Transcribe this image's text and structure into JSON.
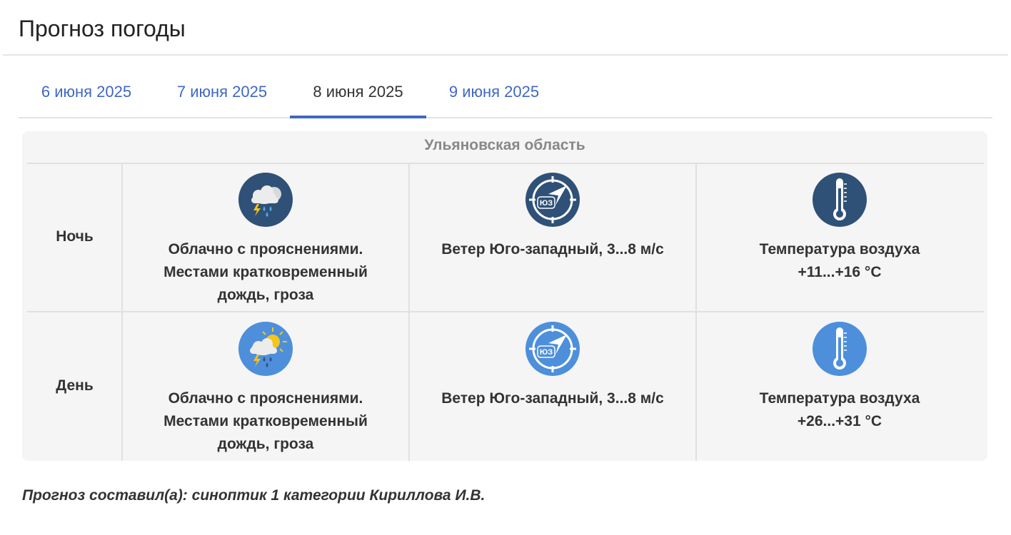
{
  "page_title": "Прогноз погоды",
  "tabs": [
    {
      "label": "6 июня 2025",
      "active": false
    },
    {
      "label": "7 июня 2025",
      "active": false
    },
    {
      "label": "8 июня 2025",
      "active": true
    },
    {
      "label": "9 июня 2025",
      "active": false
    }
  ],
  "region": "Ульяновская область",
  "rows": [
    {
      "period": "Ночь",
      "weather_icon": "night-cloud-rain-thunder-icon",
      "weather_text": "Облачно с прояснениями. Местами кратковременный дождь, гроза",
      "wind_icon": "compass-wind-sw-icon",
      "wind_dir_label": "ЮЗ",
      "wind_text": "Ветер Юго-западный, 3...8 м/с",
      "temp_icon": "thermometer-icon",
      "temp_label": "Температура воздуха",
      "temp_value": "+11...+16 °С",
      "icon_color": "#2f5177"
    },
    {
      "period": "День",
      "weather_icon": "day-sun-cloud-rain-thunder-icon",
      "weather_text": "Облачно с прояснениями. Местами кратковременный дождь, гроза",
      "wind_icon": "compass-wind-sw-icon",
      "wind_dir_label": "ЮЗ",
      "wind_text": "Ветер Юго-западный, 3...8 м/с",
      "temp_icon": "thermometer-icon",
      "temp_label": "Температура воздуха",
      "temp_value": "+26...+31 °С",
      "icon_color": "#4d8fdb"
    }
  ],
  "footer": "Прогноз составил(а): синоптик 1 категории Кириллова И.В.",
  "colors": {
    "accent": "#3f67c6",
    "night_icon": "#2f5177",
    "day_icon": "#4d8fdb",
    "panel_bg": "#f5f5f5"
  }
}
